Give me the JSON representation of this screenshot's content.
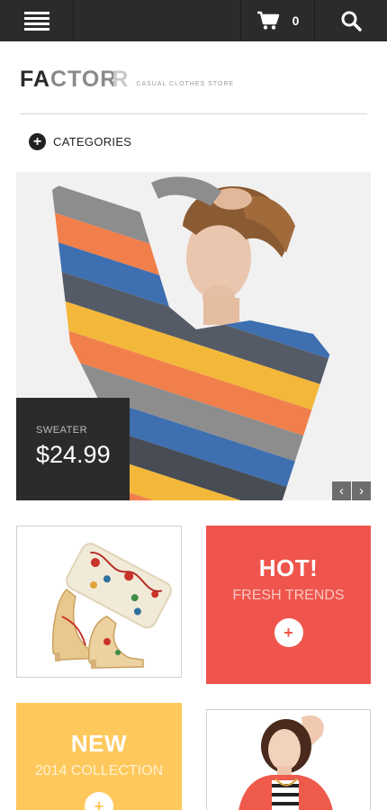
{
  "header": {
    "cart_count": "0",
    "icons": {
      "menu": "hamburger-menu-icon",
      "cart": "shopping-cart-icon",
      "search": "search-icon"
    }
  },
  "brand": {
    "logo_part1": "FA",
    "logo_part2": "CTOR",
    "logo_part3": "R",
    "tagline": "CASUAL CLOTHES STORE"
  },
  "categories": {
    "label": "CATEGORIES",
    "icon": "plus-circle-icon"
  },
  "hero": {
    "product": "SWEATER",
    "price": "$24.99",
    "prev": "‹",
    "next": "›"
  },
  "tiles": {
    "hot": {
      "title": "HOT!",
      "subtitle": "FRESH TRENDS",
      "plus": "+"
    },
    "new": {
      "title": "NEW",
      "subtitle": "2014 COLLECTION",
      "plus": "+"
    }
  },
  "colors": {
    "topbar": "#2b2b2b",
    "hot": "#ef554c",
    "new": "#fec85c",
    "price_box": "#2b2b2b"
  }
}
